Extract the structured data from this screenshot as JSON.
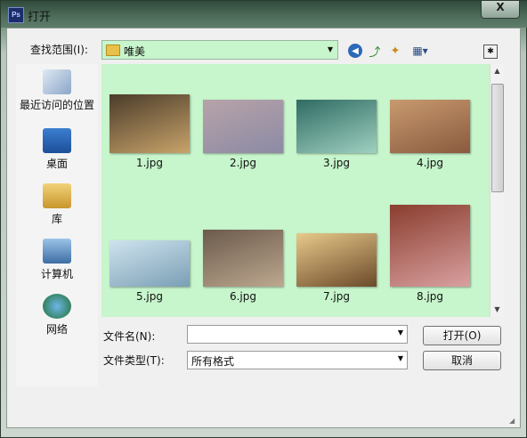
{
  "window": {
    "title": "打开",
    "close_label": "X",
    "app_icon": "Ps"
  },
  "lookin": {
    "label": "查找范围(I):",
    "value": "唯美"
  },
  "toolbar": [
    "back-icon",
    "up-folder-icon",
    "new-folder-icon",
    "views-menu-icon",
    "extra-icon"
  ],
  "places": [
    {
      "label": "最近访问的位置",
      "icon": "recent-places-icon"
    },
    {
      "label": "桌面",
      "icon": "desktop-icon"
    },
    {
      "label": "库",
      "icon": "libraries-icon"
    },
    {
      "label": "计算机",
      "icon": "computer-icon"
    },
    {
      "label": "网络",
      "icon": "network-icon"
    }
  ],
  "files": [
    {
      "name": "1.jpg",
      "colors": [
        "#4a3b2a",
        "#c9a46a"
      ]
    },
    {
      "name": "2.jpg",
      "colors": [
        "#b7a3a8",
        "#8c8aa5"
      ]
    },
    {
      "name": "3.jpg",
      "colors": [
        "#2f6b63",
        "#9fd0c0"
      ]
    },
    {
      "name": "4.jpg",
      "colors": [
        "#c89a6f",
        "#8a5a3e"
      ]
    },
    {
      "name": "5.jpg",
      "colors": [
        "#cfe3ee",
        "#7a9fb5"
      ]
    },
    {
      "name": "6.jpg",
      "colors": [
        "#6c5a4c",
        "#bca88f"
      ]
    },
    {
      "name": "7.jpg",
      "colors": [
        "#e8c98a",
        "#6b4a2a"
      ]
    },
    {
      "name": "8.jpg",
      "colors": [
        "#8a3d2e",
        "#d9a0a0"
      ]
    }
  ],
  "filename": {
    "label": "文件名(N):",
    "value": ""
  },
  "filetype": {
    "label": "文件类型(T):",
    "value": "所有格式"
  },
  "buttons": {
    "open": "打开(O)",
    "cancel": "取消"
  },
  "colors": {
    "view_bg": "#c7f5cc",
    "title_bg": "#4d6b59"
  }
}
